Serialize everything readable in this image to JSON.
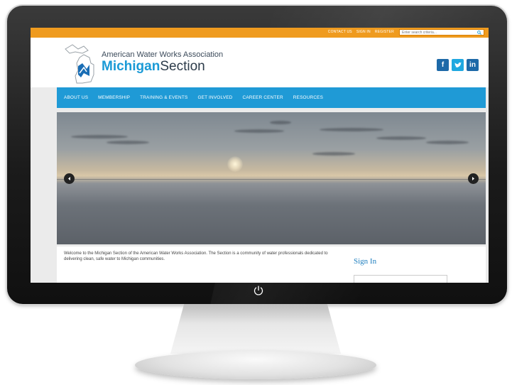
{
  "topbar": {
    "links": [
      "CONTACT US",
      "SIGN IN",
      "REGISTER"
    ],
    "search_placeholder": "Enter search criteria...",
    "accent": "#ef9b1f"
  },
  "header": {
    "org_name": "American Water Works Association",
    "section_bold": "Michigan",
    "section_rest": "Section",
    "social": {
      "facebook": "f",
      "twitter": "t",
      "linkedin": "in"
    }
  },
  "nav": {
    "items": [
      "ABOUT US",
      "MEMBERSHIP",
      "TRAINING & EVENTS",
      "GET INVOLVED",
      "CAREER CENTER",
      "RESOURCES"
    ],
    "color": "#1f9ad6"
  },
  "hero": {
    "icons": {
      "prev": "chevron-left-icon",
      "next": "chevron-right-icon"
    }
  },
  "content": {
    "welcome": "Welcome to the Michigan Section of the American Water Works Association. The Section is a community of water professionals dedicated to delivering clean, safe water to Michigan communities.",
    "signin_title": "Sign In"
  },
  "device": {
    "power_icon": "power-icon"
  }
}
